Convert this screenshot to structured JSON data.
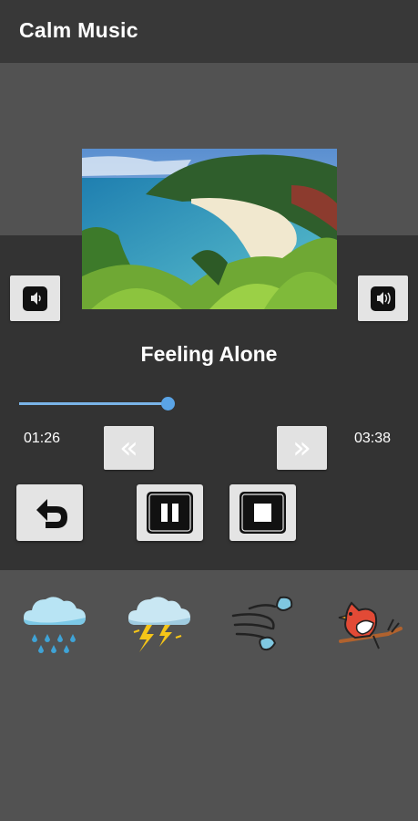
{
  "app": {
    "title": "Calm Music"
  },
  "player": {
    "track_title": "Feeling Alone",
    "elapsed": "01:26",
    "duration": "03:38",
    "progress_fraction": 0.39,
    "rewind_glyph": "«",
    "forward_glyph": "»"
  },
  "icons": {
    "artwork": "beach-landscape-image",
    "volume_down": "speaker-low-icon",
    "volume_up": "speaker-high-icon",
    "replay": "undo-arrow-icon",
    "pause": "pause-icon",
    "stop": "stop-icon"
  },
  "sounds": [
    {
      "name": "rain-icon"
    },
    {
      "name": "thunderstorm-icon"
    },
    {
      "name": "wind-icon"
    },
    {
      "name": "bird-icon"
    }
  ],
  "colors": {
    "appbar": "#383838",
    "background": "#525252",
    "panel": "#333333",
    "seek_accent": "#5aa4e6"
  }
}
